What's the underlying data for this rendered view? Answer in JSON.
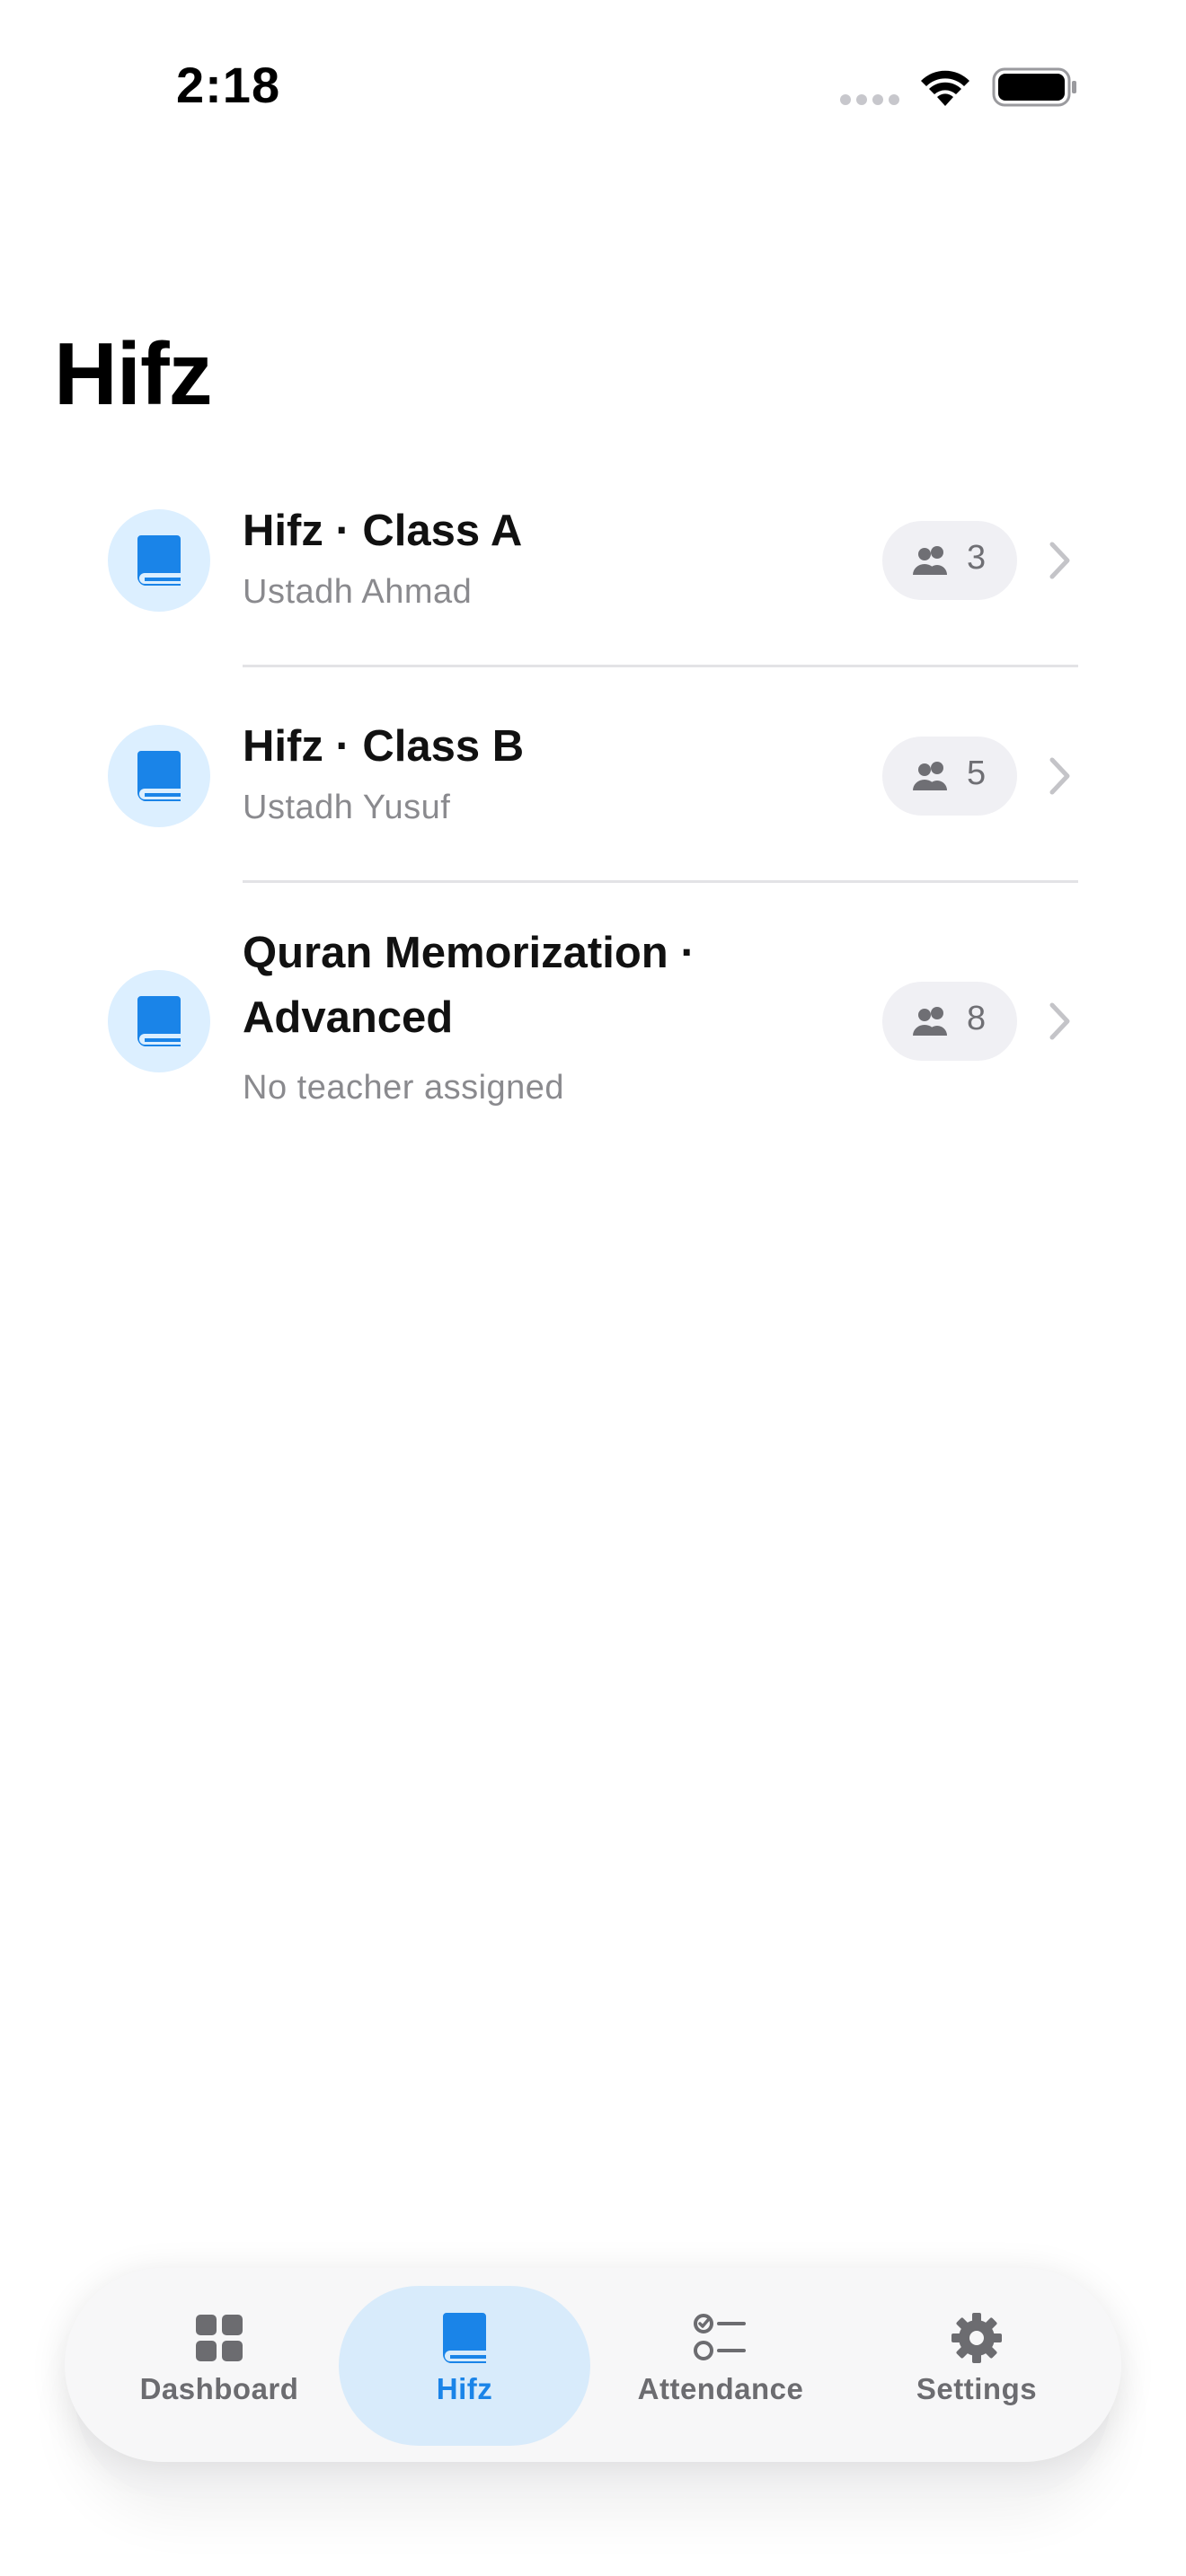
{
  "status_bar": {
    "time": "2:18"
  },
  "page": {
    "title": "Hifz"
  },
  "colors": {
    "accent": "#1a84e8",
    "icon_badge_bg": "#dcefff",
    "secondary_text": "#8a8a8e",
    "pill_bg": "#f0f0f4"
  },
  "classes": [
    {
      "title": "Hifz · Class A",
      "teacher": "Ustadh Ahmad",
      "student_count": "3",
      "icon": "book-icon"
    },
    {
      "title": "Hifz · Class B",
      "teacher": "Ustadh Yusuf",
      "student_count": "5",
      "icon": "book-icon"
    },
    {
      "title": "Quran Memorization · Advanced",
      "teacher": "No teacher assigned",
      "student_count": "8",
      "icon": "book-icon"
    }
  ],
  "tab_bar": {
    "tabs": [
      {
        "label": "Dashboard",
        "icon": "grid-icon",
        "selected": false
      },
      {
        "label": "Hifz",
        "icon": "book-icon",
        "selected": true
      },
      {
        "label": "Attendance",
        "icon": "checklist-icon",
        "selected": false
      },
      {
        "label": "Settings",
        "icon": "gear-icon",
        "selected": false
      }
    ]
  }
}
